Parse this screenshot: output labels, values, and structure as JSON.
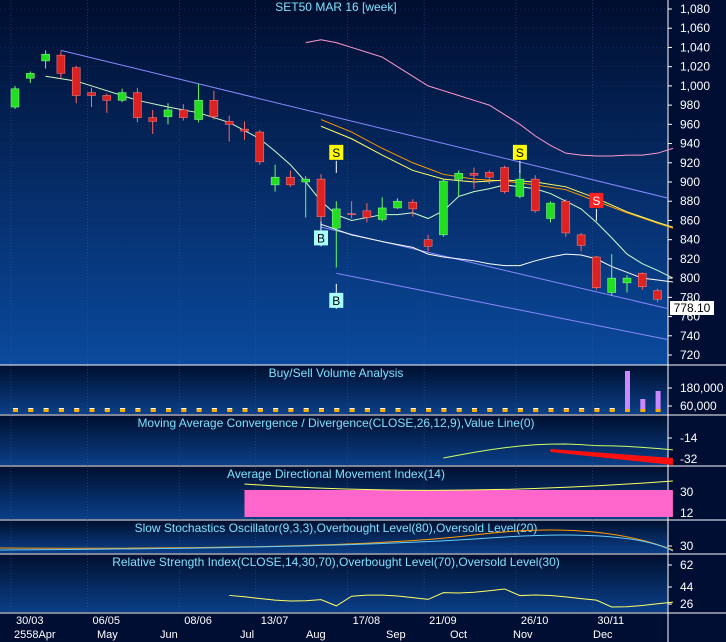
{
  "chart_data": {
    "type": "candlestick",
    "title": "SET50 MAR 16  [week]",
    "last_price": "778.10",
    "price_axis": {
      "ylim": [
        720,
        1080
      ],
      "ticks": [
        1080,
        1060,
        1040,
        1020,
        1000,
        980,
        960,
        940,
        920,
        900,
        880,
        860,
        840,
        820,
        800,
        780,
        760,
        740,
        720
      ]
    },
    "date_labels": [
      "30/03",
      "06/05",
      "08/06",
      "13/07",
      "17/08",
      "21/09",
      "26/10",
      "30/11"
    ],
    "month_labels": [
      "2558Apr",
      "May",
      "Jun",
      "Jul",
      "Aug",
      "Sep",
      "Oct",
      "Nov",
      "Dec"
    ],
    "candles": [
      {
        "o": 978,
        "h": 1000,
        "l": 976,
        "c": 997
      },
      {
        "o": 1008,
        "h": 1015,
        "l": 1003,
        "c": 1013
      },
      {
        "o": 1026,
        "h": 1037,
        "l": 1018,
        "c": 1033
      },
      {
        "o": 1032,
        "h": 1036,
        "l": 1008,
        "c": 1013
      },
      {
        "o": 1019,
        "h": 1021,
        "l": 982,
        "c": 990
      },
      {
        "o": 993,
        "h": 998,
        "l": 978,
        "c": 990
      },
      {
        "o": 990,
        "h": 992,
        "l": 972,
        "c": 985
      },
      {
        "o": 985,
        "h": 997,
        "l": 983,
        "c": 993
      },
      {
        "o": 993,
        "h": 998,
        "l": 962,
        "c": 967
      },
      {
        "o": 967,
        "h": 975,
        "l": 950,
        "c": 963
      },
      {
        "o": 968,
        "h": 982,
        "l": 960,
        "c": 975
      },
      {
        "o": 975,
        "h": 981,
        "l": 964,
        "c": 967
      },
      {
        "o": 965,
        "h": 1002,
        "l": 962,
        "c": 985
      },
      {
        "o": 985,
        "h": 995,
        "l": 965,
        "c": 968
      },
      {
        "o": 963,
        "h": 969,
        "l": 942,
        "c": 960
      },
      {
        "o": 955,
        "h": 963,
        "l": 944,
        "c": 953
      },
      {
        "o": 952,
        "h": 954,
        "l": 918,
        "c": 921
      },
      {
        "o": 897,
        "h": 918,
        "l": 890,
        "c": 905
      },
      {
        "o": 905,
        "h": 912,
        "l": 895,
        "c": 897
      },
      {
        "o": 900,
        "h": 906,
        "l": 863,
        "c": 903
      },
      {
        "o": 903,
        "h": 908,
        "l": 855,
        "c": 864
      },
      {
        "o": 852,
        "h": 880,
        "l": 811,
        "c": 872
      },
      {
        "o": 867,
        "h": 880,
        "l": 862,
        "c": 866
      },
      {
        "o": 870,
        "h": 878,
        "l": 858,
        "c": 863
      },
      {
        "o": 861,
        "h": 884,
        "l": 859,
        "c": 873
      },
      {
        "o": 873,
        "h": 883,
        "l": 872,
        "c": 880
      },
      {
        "o": 879,
        "h": 882,
        "l": 864,
        "c": 872
      },
      {
        "o": 840,
        "h": 845,
        "l": 828,
        "c": 833
      },
      {
        "o": 845,
        "h": 903,
        "l": 843,
        "c": 901
      },
      {
        "o": 903,
        "h": 912,
        "l": 885,
        "c": 909
      },
      {
        "o": 909,
        "h": 915,
        "l": 893,
        "c": 907
      },
      {
        "o": 910,
        "h": 912,
        "l": 898,
        "c": 905
      },
      {
        "o": 915,
        "h": 917,
        "l": 888,
        "c": 890
      },
      {
        "o": 885,
        "h": 912,
        "l": 883,
        "c": 903
      },
      {
        "o": 903,
        "h": 907,
        "l": 868,
        "c": 870
      },
      {
        "o": 862,
        "h": 880,
        "l": 858,
        "c": 878
      },
      {
        "o": 880,
        "h": 882,
        "l": 843,
        "c": 847
      },
      {
        "o": 845,
        "h": 847,
        "l": 828,
        "c": 834
      },
      {
        "o": 822,
        "h": 823,
        "l": 788,
        "c": 790
      },
      {
        "o": 785,
        "h": 825,
        "l": 782,
        "c": 800
      },
      {
        "o": 795,
        "h": 803,
        "l": 785,
        "c": 800
      },
      {
        "o": 805,
        "h": 806,
        "l": 788,
        "c": 791
      },
      {
        "o": 787,
        "h": 789,
        "l": 775,
        "c": 778
      }
    ],
    "ma_upper": [
      [
        19,
        1045
      ],
      [
        20,
        1048
      ],
      [
        21,
        1045
      ],
      [
        22,
        1040
      ],
      [
        23,
        1035
      ],
      [
        24,
        1030
      ],
      [
        25,
        1020
      ],
      [
        26,
        1010
      ],
      [
        27,
        1000
      ],
      [
        28,
        995
      ],
      [
        29,
        990
      ],
      [
        30,
        985
      ],
      [
        31,
        980
      ],
      [
        32,
        970
      ],
      [
        33,
        960
      ],
      [
        34,
        948
      ],
      [
        35,
        938
      ],
      [
        36,
        930
      ],
      [
        37,
        928
      ],
      [
        38,
        927
      ],
      [
        39,
        927
      ],
      [
        40,
        928
      ],
      [
        41,
        928
      ],
      [
        42,
        930
      ],
      [
        43,
        935
      ]
    ],
    "ma_fast": [
      [
        2,
        1010
      ],
      [
        4,
        1005
      ],
      [
        6,
        995
      ],
      [
        8,
        985
      ],
      [
        10,
        978
      ],
      [
        12,
        972
      ],
      [
        14,
        962
      ],
      [
        16,
        945
      ],
      [
        17,
        932
      ],
      [
        18,
        918
      ],
      [
        19,
        900
      ],
      [
        20,
        880
      ],
      [
        21,
        866
      ],
      [
        22,
        860
      ],
      [
        23,
        863
      ],
      [
        24,
        866
      ],
      [
        25,
        866
      ],
      [
        26,
        868
      ],
      [
        27,
        862
      ],
      [
        28,
        870
      ],
      [
        29,
        885
      ],
      [
        30,
        890
      ],
      [
        31,
        893
      ],
      [
        32,
        897
      ],
      [
        33,
        895
      ],
      [
        34,
        893
      ],
      [
        35,
        888
      ],
      [
        36,
        880
      ],
      [
        37,
        872
      ],
      [
        38,
        858
      ],
      [
        39,
        842
      ],
      [
        40,
        825
      ],
      [
        41,
        815
      ],
      [
        42,
        808
      ],
      [
        43,
        800
      ]
    ],
    "ma_mid": [
      [
        20,
        965
      ],
      [
        22,
        952
      ],
      [
        24,
        935
      ],
      [
        26,
        920
      ],
      [
        28,
        908
      ],
      [
        30,
        903
      ],
      [
        32,
        901
      ],
      [
        34,
        897
      ],
      [
        36,
        892
      ],
      [
        38,
        880
      ],
      [
        40,
        868
      ],
      [
        42,
        857
      ],
      [
        43,
        852
      ]
    ],
    "ma_slow": [
      [
        20,
        958
      ],
      [
        22,
        945
      ],
      [
        24,
        928
      ],
      [
        26,
        912
      ],
      [
        28,
        903
      ],
      [
        30,
        900
      ],
      [
        32,
        902
      ],
      [
        34,
        900
      ],
      [
        36,
        895
      ],
      [
        38,
        883
      ],
      [
        40,
        869
      ],
      [
        42,
        858
      ],
      [
        43,
        853
      ]
    ],
    "ma_lower": [
      [
        20,
        856
      ],
      [
        22,
        845
      ],
      [
        24,
        838
      ],
      [
        26,
        832
      ],
      [
        27,
        825
      ],
      [
        28,
        822
      ],
      [
        29,
        820
      ],
      [
        30,
        818
      ],
      [
        31,
        815
      ],
      [
        32,
        813
      ],
      [
        33,
        813
      ],
      [
        34,
        818
      ],
      [
        35,
        822
      ],
      [
        36,
        825
      ],
      [
        37,
        824
      ],
      [
        38,
        820
      ],
      [
        39,
        812
      ],
      [
        40,
        806
      ],
      [
        41,
        800
      ],
      [
        42,
        798
      ],
      [
        43,
        796
      ]
    ],
    "signals": [
      {
        "type": "S",
        "i": 21,
        "price": 922
      },
      {
        "type": "S",
        "i": 33,
        "price": 922
      },
      {
        "type": "S",
        "i": 38,
        "price": 872
      },
      {
        "type": "B",
        "i": 20,
        "price": 833
      },
      {
        "type": "B",
        "i": 21,
        "price": 768
      }
    ],
    "channel_lines": [
      {
        "p1": [
          3,
          1037
        ],
        "p2": [
          43,
          882
        ]
      },
      {
        "p1": [
          20,
          853
        ],
        "p2": [
          43,
          767
        ]
      },
      {
        "p1": [
          21,
          805
        ],
        "p2": [
          43,
          735
        ]
      }
    ],
    "panels": [
      {
        "title": "Buy/Sell Volume Analysis",
        "ticks": [
          "180,000",
          "60,000"
        ]
      },
      {
        "title": "Moving Average Convergence / Divergence(CLOSE,26,12,9),Value Line(0)",
        "ticks": [
          "-14",
          "-32"
        ]
      },
      {
        "title": "Average Directional Movement Index(14)",
        "ticks": [
          "30",
          "12"
        ]
      },
      {
        "title": "Slow Stochastics Oscillator(9,3,3),Overbought Level(80),Oversold Level(20)",
        "ticks": [
          "30"
        ]
      },
      {
        "title": "Relative Strength Index(CLOSE,14,30,70),Overbought Level(70),Oversold Level(30)",
        "ticks": [
          "62",
          "44",
          "26"
        ]
      }
    ]
  }
}
